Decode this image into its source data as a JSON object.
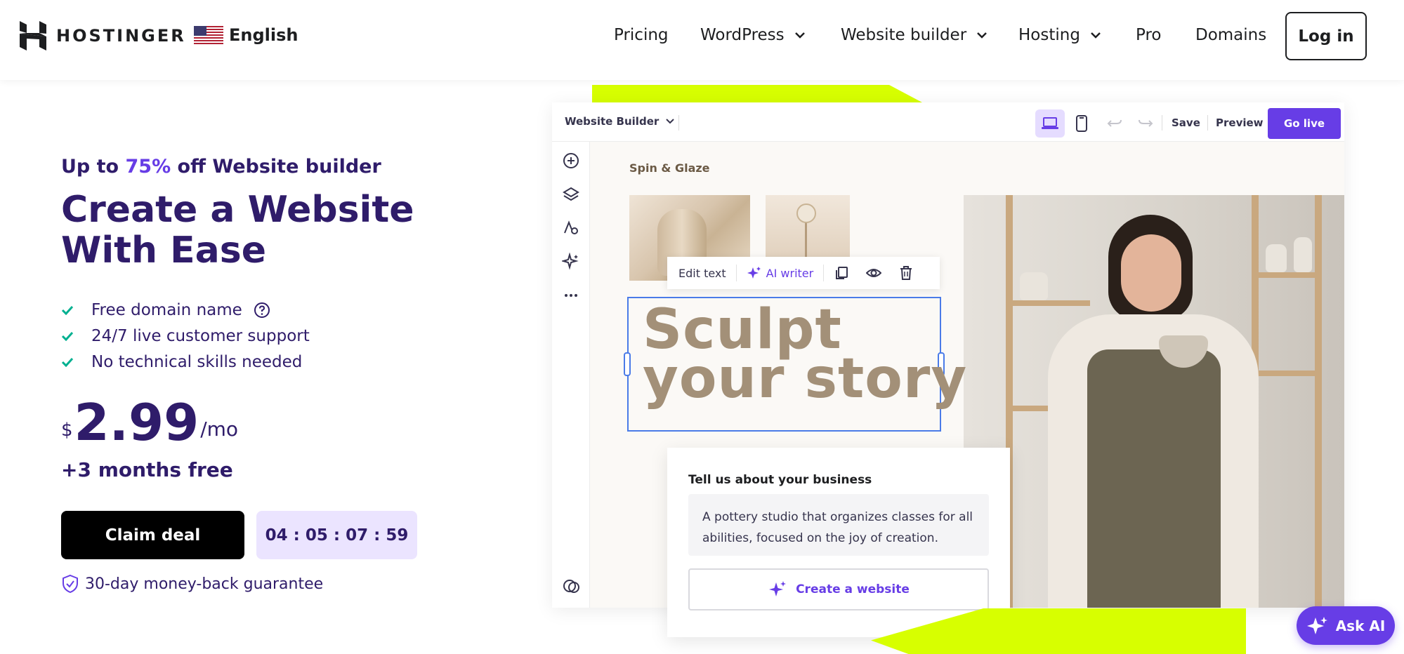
{
  "header": {
    "brand": "HOSTINGER",
    "language": "English",
    "nav": [
      {
        "label": "Pricing",
        "dropdown": false
      },
      {
        "label": "WordPress",
        "dropdown": true
      },
      {
        "label": "Website builder",
        "dropdown": true
      },
      {
        "label": "Hosting",
        "dropdown": true
      },
      {
        "label": "Pro",
        "dropdown": false
      },
      {
        "label": "Domains",
        "dropdown": false
      }
    ],
    "login_label": "Log in"
  },
  "hero": {
    "promo_prefix": "Up to ",
    "promo_percent": "75%",
    "promo_suffix": " off Website builder",
    "headline": "Create a Website With Ease",
    "features": [
      {
        "label": "Free domain name",
        "help": true
      },
      {
        "label": "24/7 live customer support",
        "help": false
      },
      {
        "label": "No technical skills needed",
        "help": false
      }
    ],
    "currency": "$",
    "price": "2.99",
    "period": "/mo",
    "bonus": "+3 months free",
    "cta_label": "Claim deal",
    "countdown": "04 : 05 : 07 : 59",
    "guarantee": "30-day money-back guarantee"
  },
  "editor": {
    "brand_label": "Website Builder",
    "save_label": "Save",
    "preview_label": "Preview",
    "golive_label": "Go live",
    "site_name": "Spin & Glaze",
    "text_toolbar": {
      "edit_label": "Edit text",
      "ai_label": "AI writer"
    },
    "headline": "Sculpt\nyour story",
    "card_title": "Tell us about your business",
    "card_input": "A pottery studio that organizes classes for all abilities, focused on the joy of creation.",
    "create_label": "Create a website"
  },
  "ask_ai_label": "Ask AI",
  "colors": {
    "brand_purple": "#673de6",
    "navy": "#2f1c6a",
    "lime": "#d7ff00",
    "check_green": "#00b090"
  }
}
